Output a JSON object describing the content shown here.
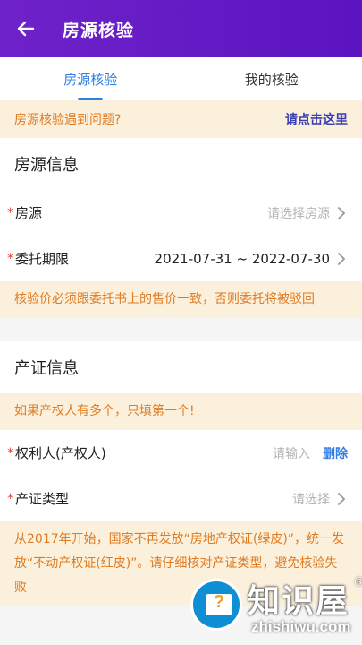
{
  "header": {
    "title": "房源核验"
  },
  "tabs": [
    {
      "label": "房源核验",
      "active": true
    },
    {
      "label": "我的核验",
      "active": false
    }
  ],
  "notice": {
    "question": "房源核验遇到问题?",
    "link": "请点击这里"
  },
  "house_section": {
    "title": "房源信息",
    "rows": [
      {
        "label": "房源",
        "required": true,
        "placeholder": "请选择房源"
      },
      {
        "label": "委托期限",
        "required": true,
        "value": "2021-07-31 ~ 2022-07-30"
      }
    ],
    "warning": "核验价必须跟委托书上的售价一致，否则委托将被驳回"
  },
  "cert_section": {
    "title": "产证信息",
    "tip": "如果产权人有多个，只填第一个!",
    "rows": [
      {
        "label": "权利人(产权人)",
        "required": true,
        "placeholder": "请输入",
        "action": "删除"
      },
      {
        "label": "产证类型",
        "required": true,
        "placeholder": "请选择"
      }
    ],
    "warning": "从2017年开始，国家不再发放“房地产权证(绿皮)”，统一发放“不动产权证(红皮)”。请仔细核对产证类型，避免核验失败"
  },
  "watermark": {
    "brand": "知识屋",
    "reg": "®",
    "site": "zhishiwu.com"
  },
  "colors": {
    "header": "#6f22c9",
    "accent": "#2f7ee6",
    "warning_text": "#e07b22",
    "warning_bg": "#fbf0dc",
    "required": "#e2402c",
    "link": "#3a3fb3"
  }
}
